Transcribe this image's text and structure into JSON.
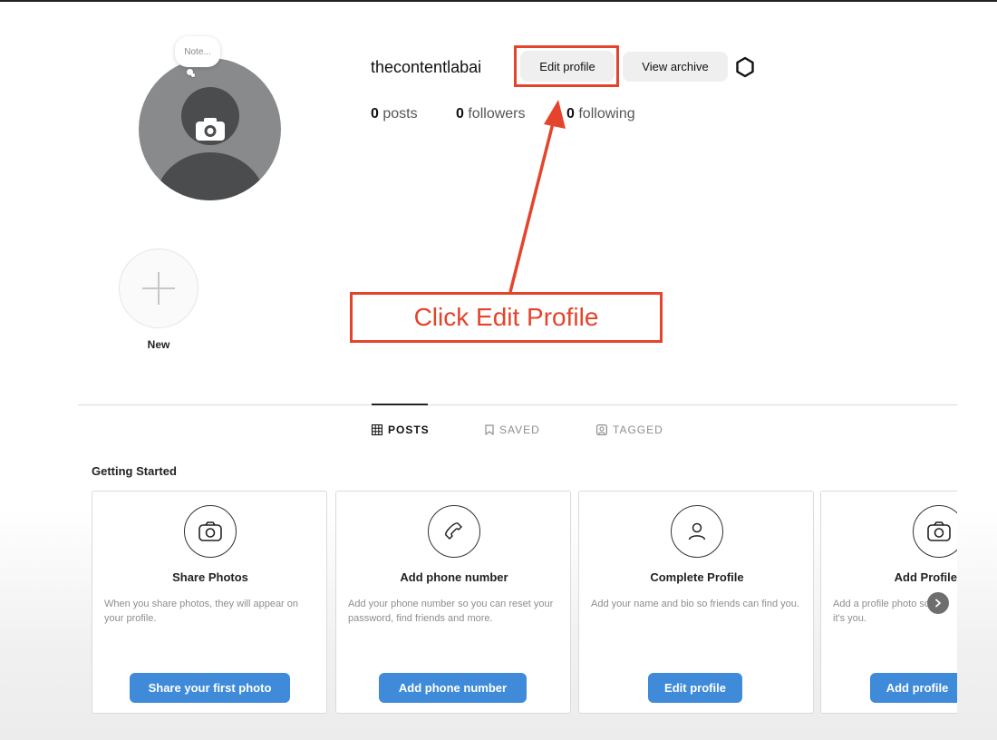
{
  "profile": {
    "username": "thecontentlabai",
    "note_placeholder": "Note...",
    "edit_profile_label": "Edit profile",
    "view_archive_label": "View archive",
    "stats": {
      "posts_count": "0",
      "posts_label": "posts",
      "followers_count": "0",
      "followers_label": "followers",
      "following_count": "0",
      "following_label": "following"
    }
  },
  "highlights": {
    "new_label": "New"
  },
  "annotation": {
    "callout_text": "Click Edit Profile",
    "color": "#e4442c"
  },
  "tabs": [
    {
      "label": "POSTS",
      "icon": "grid-icon",
      "active": true
    },
    {
      "label": "SAVED",
      "icon": "bookmark-icon",
      "active": false
    },
    {
      "label": "TAGGED",
      "icon": "tagged-icon",
      "active": false
    }
  ],
  "getting_started": {
    "heading": "Getting Started",
    "cards": [
      {
        "icon": "camera-icon",
        "title": "Share Photos",
        "desc": "When you share photos, they will appear on your profile.",
        "cta": "Share your first photo"
      },
      {
        "icon": "phone-icon",
        "title": "Add phone number",
        "desc": "Add your phone number so you can reset your password, find friends and more.",
        "cta": "Add phone number"
      },
      {
        "icon": "person-icon",
        "title": "Complete Profile",
        "desc": "Add your name and bio so friends can find you.",
        "cta": "Edit profile"
      },
      {
        "icon": "camera-icon",
        "title": "Add Profile",
        "desc": "Add a profile photo so it's you.",
        "cta": "Add profile"
      }
    ]
  },
  "colors": {
    "button_blue": "#3f8bd9",
    "annotation_red": "#e4442c"
  }
}
